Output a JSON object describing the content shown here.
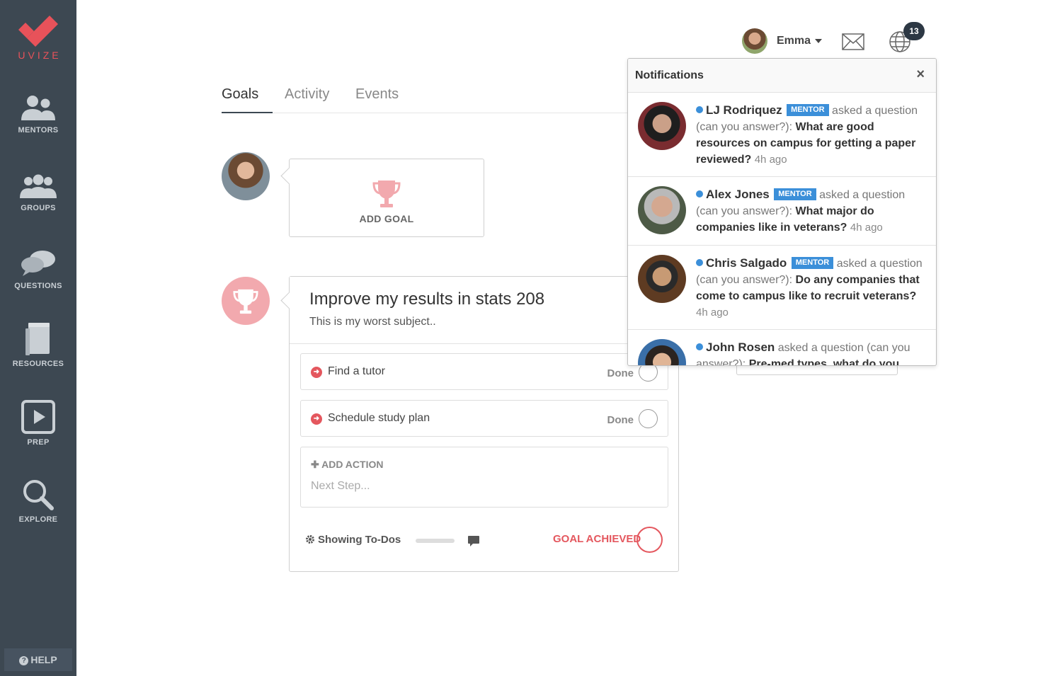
{
  "brand": {
    "name": "UVIZE",
    "color": "#e8525a"
  },
  "sidebar": {
    "items": [
      {
        "label": "MENTORS",
        "icon": "mentors-icon"
      },
      {
        "label": "GROUPS",
        "icon": "groups-icon"
      },
      {
        "label": "QUESTIONS",
        "icon": "questions-icon"
      },
      {
        "label": "RESOURCES",
        "icon": "resources-icon"
      },
      {
        "label": "PREP",
        "icon": "prep-icon"
      },
      {
        "label": "EXPLORE",
        "icon": "explore-icon"
      }
    ],
    "help_label": "HELP"
  },
  "header": {
    "user_name": "Emma",
    "notification_count": "13"
  },
  "tabs": [
    {
      "label": "Goals",
      "active": true
    },
    {
      "label": "Activity",
      "active": false
    },
    {
      "label": "Events",
      "active": false
    }
  ],
  "add_goal": {
    "label": "ADD GOAL"
  },
  "goal": {
    "title": "Improve my results in stats 208",
    "subtitle": "This is my worst subject..",
    "actions": [
      {
        "label": "Find a tutor",
        "status": "Done"
      },
      {
        "label": "Schedule study plan",
        "status": "Done"
      }
    ],
    "add_action_label": "ADD ACTION",
    "add_action_placeholder": "Next Step...",
    "showing_label": "Showing To-Dos",
    "achieved_label": "GOAL ACHIEVED"
  },
  "notifications": {
    "title": "Notifications",
    "close_symbol": "×",
    "items": [
      {
        "name": "LJ Rodriquez",
        "badge": "MENTOR",
        "verb": "asked a question",
        "prefix": "(can you answer?):",
        "question": "What are good resources on campus for getting a paper reviewed?",
        "time": "4h ago"
      },
      {
        "name": "Alex Jones",
        "badge": "MENTOR",
        "verb": "asked a question",
        "prefix": "(can you answer?):",
        "question": "What major do companies like in veterans?",
        "time": "4h ago"
      },
      {
        "name": "Chris Salgado",
        "badge": "MENTOR",
        "verb": "asked a question",
        "prefix": "(can you answer?):",
        "question": "Do any companies that come to campus like to recruit veterans?",
        "time": "4h ago"
      },
      {
        "name": "John Rosen",
        "badge": "",
        "verb": "asked a question (can you",
        "prefix": "answer?):",
        "question": "Pre-med types, what do you",
        "time": ""
      }
    ]
  },
  "colors": {
    "sidebar_bg": "#3d4852",
    "accent_red": "#e4575e",
    "mentor_blue": "#3b8fd9",
    "trophy_pink": "#f2a9ae"
  }
}
